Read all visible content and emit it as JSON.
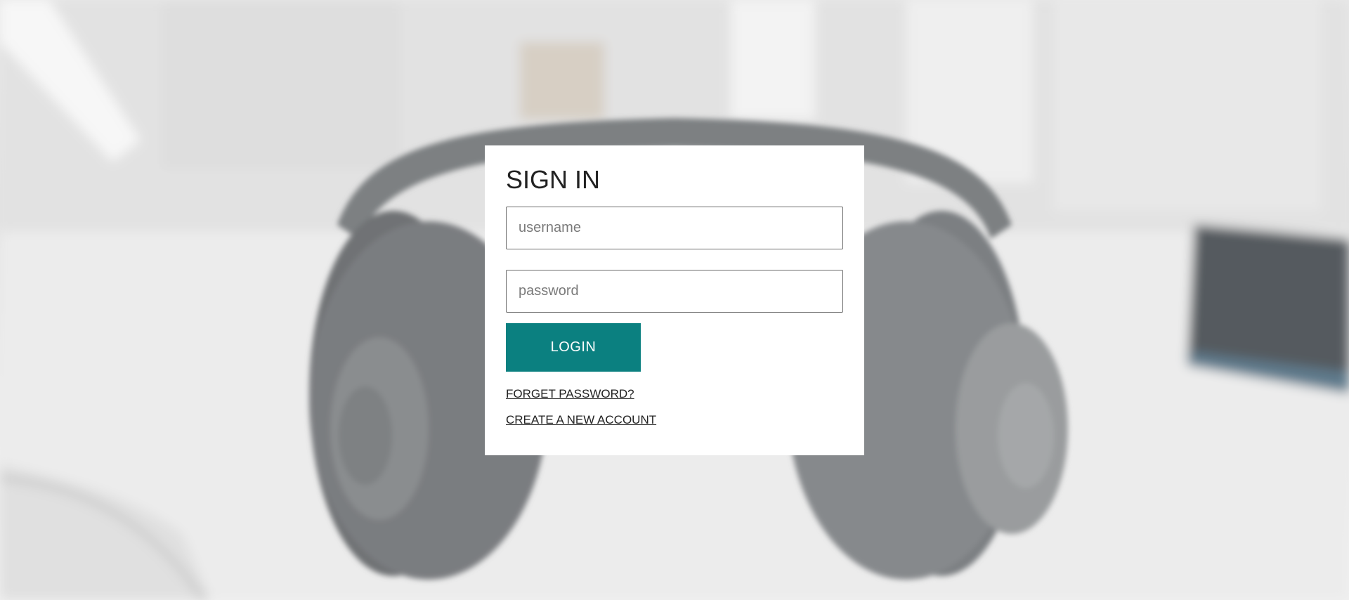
{
  "login": {
    "title": "SIGN IN",
    "username_placeholder": "username",
    "username_value": "",
    "password_placeholder": "password",
    "password_value": "",
    "login_label": "LOGIN",
    "forgot_label": "FORGET PASSWORD?",
    "create_label": "CREATE A NEW ACCOUNT"
  },
  "colors": {
    "accent": "#0b8080",
    "card_background": "#ffffff",
    "page_background": "#e6e6e6"
  },
  "background": {
    "image_subject": "headphones-on-desk-photo"
  }
}
